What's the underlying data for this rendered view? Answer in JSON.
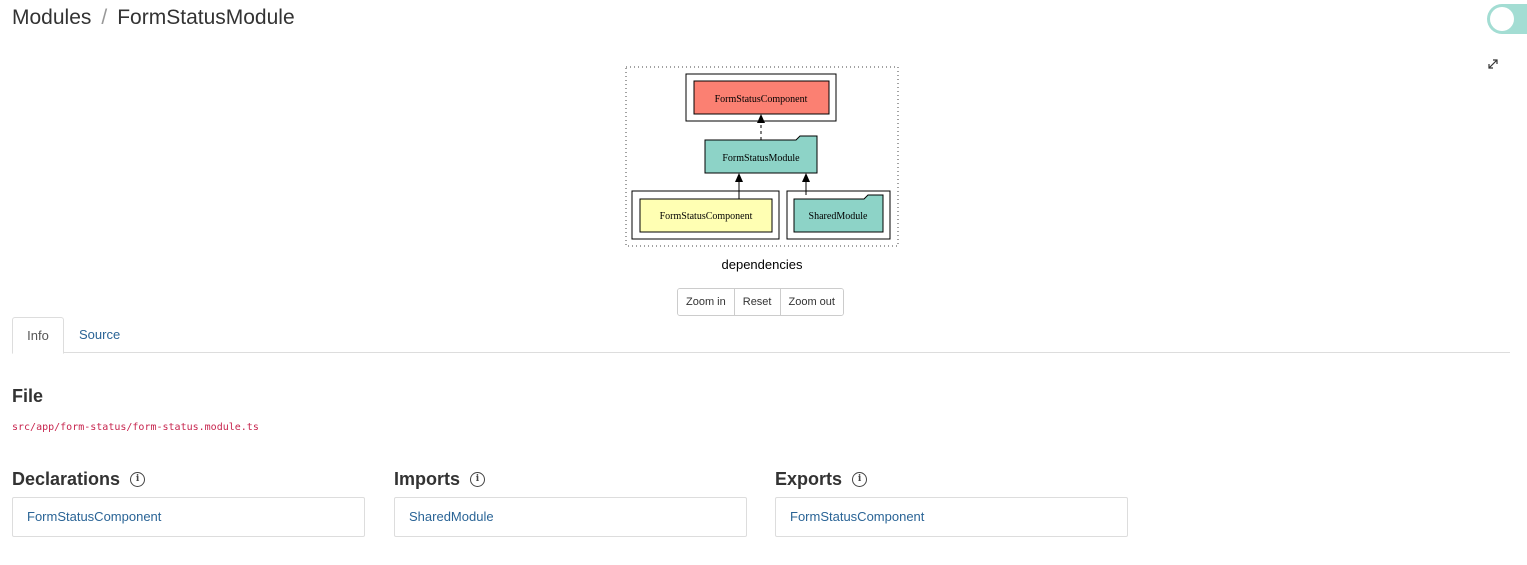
{
  "breadcrumb": {
    "root": "Modules",
    "separator": "/",
    "current": "FormStatusModule"
  },
  "graph": {
    "nodes": {
      "top": "FormStatusComponent",
      "module": "FormStatusModule",
      "declaration": "FormStatusComponent",
      "import": "SharedModule"
    },
    "caption": "dependencies",
    "colors": {
      "component_export": "#fb8072",
      "module": "#8dd3c7",
      "declaration": "#ffffb3"
    }
  },
  "zoom": {
    "zoom_in": "Zoom in",
    "reset": "Reset",
    "zoom_out": "Zoom out"
  },
  "tabs": [
    {
      "label": "Info",
      "active": true
    },
    {
      "label": "Source",
      "active": false
    }
  ],
  "file": {
    "heading": "File",
    "path": "src/app/form-status/form-status.module.ts"
  },
  "sections": {
    "declarations": {
      "heading": "Declarations",
      "items": [
        "FormStatusComponent"
      ]
    },
    "imports": {
      "heading": "Imports",
      "items": [
        "SharedModule"
      ]
    },
    "exports": {
      "heading": "Exports",
      "items": [
        "FormStatusComponent"
      ]
    }
  },
  "icons": {
    "info": "info-circle-icon",
    "expand": "expand-arrows-icon"
  },
  "theme": {
    "link": "#2a6496",
    "code": "#c7254e",
    "toggle": "#a3ddd3"
  }
}
